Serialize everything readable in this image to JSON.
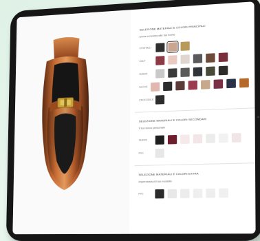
{
  "primary": {
    "title": "Selezione materiali e colori principali",
    "subtitle": "Dona un'anima alle tue forme",
    "rows": [
      {
        "label": "Cristalli",
        "colors": [
          "#2f2f2f",
          "#caa590",
          "#b89a5a"
        ],
        "selected": 1
      },
      {
        "label": "Calf",
        "colors": [
          "#8c3a44",
          "#e9c9c2",
          "#e0d6cf",
          "#5a5a5a",
          "#6e4a3b",
          "#7a2e3b"
        ],
        "selected": -1
      },
      {
        "label": "Suede",
        "colors": [
          "#c9c9c9",
          "#3b3b3b",
          "#5a5a5a",
          "#2f3238",
          "#4a4a3a",
          "#2e2b2b"
        ],
        "selected": -1
      },
      {
        "label": "Glove",
        "colors": [
          "#e0b8b0",
          "#2c2c2c",
          "#5c3a3a",
          "#9a3b4f",
          "#c8a88a",
          "#7a3045",
          "#2a3248",
          "#b66a2a"
        ],
        "selected": -1
      },
      {
        "label": "Crocodile",
        "colors": [
          "#2d2d2d"
        ],
        "selected": -1
      }
    ]
  },
  "secondary": {
    "title": "Selezione materiali e colori secondari",
    "subtitle": "Il tuo tocco personale",
    "rows": [
      {
        "label": "Suede",
        "colors": [
          "#1f1f1f",
          "#6e1e2c",
          "#f5e9ea",
          "#f2e6e8",
          "#ececec",
          "#f2f2f2",
          "#f0e6e8"
        ],
        "selected": -1
      },
      {
        "label": "PVC",
        "colors": [
          "#e7e7e7"
        ],
        "selected": -1
      }
    ]
  },
  "extra": {
    "title": "Selezione materiali e colori extra",
    "subtitle": "Impreziosisci il tuo modello",
    "rows": [
      {
        "label": "PVC",
        "colors": [
          "#2b2b2b",
          "#e8e8e8",
          "#ececec",
          "#efefef",
          "#eeeeee",
          "#f0f0f0"
        ],
        "selected": -1
      }
    ]
  }
}
